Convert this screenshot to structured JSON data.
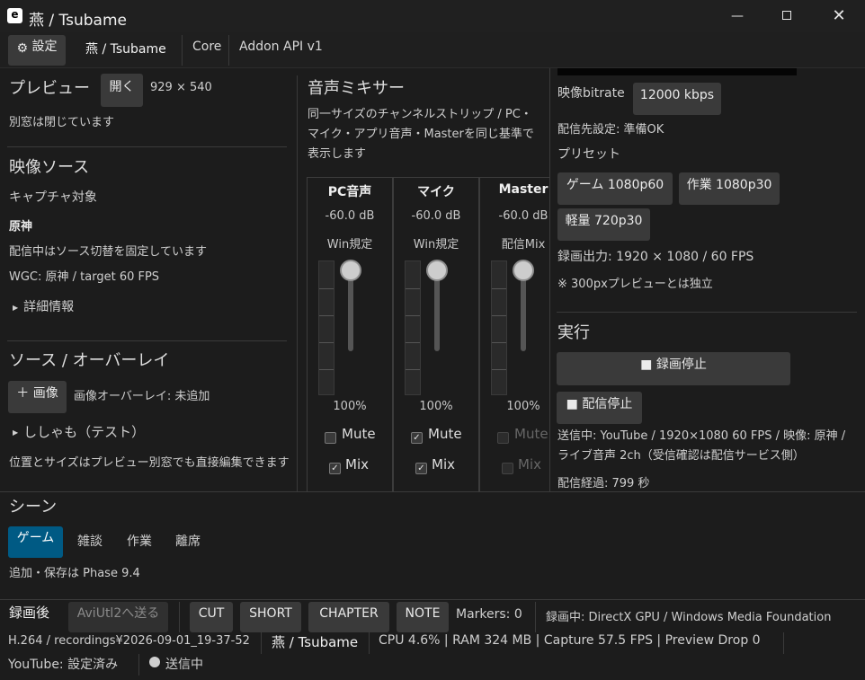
{
  "window": {
    "app_icon": "e",
    "title": "燕 / Tsubame"
  },
  "menu": {
    "settings_label": "設定",
    "tabs": [
      "燕 / Tsubame",
      "Core",
      "Addon API v1"
    ]
  },
  "preview": {
    "title": "プレビュー",
    "open_label": "開く",
    "size": "929 × 540",
    "status": "別窓は閉じています"
  },
  "video_source": {
    "title": "映像ソース",
    "capture_target_label": "キャプチャ対象",
    "capture_target": "原神",
    "note": "配信中はソース切替を固定しています",
    "wgc": "WGC: 原神 / target 60 FPS",
    "details_label": "詳細情報"
  },
  "overlay": {
    "title": "ソース / オーバーレイ",
    "add_image_label": "＋ 画像",
    "image_status": "画像オーバーレイ: 未追加",
    "item": "ししゃも（テスト）",
    "note": "位置とサイズはプレビュー別窓でも直接編集できます"
  },
  "mixer": {
    "title": "音声ミキサー",
    "description": "同一サイズのチャンネルストリップ / PC・マイク・アプリ音声・Masterを同じ基準で表示します",
    "strips": [
      {
        "name": "PC音声",
        "db": "-60.0 dB",
        "source": "Win規定",
        "level": "100%",
        "mute": false,
        "mix": true,
        "mute_label": "Mute",
        "mix_label": "Mix"
      },
      {
        "name": "マイク",
        "db": "-60.0 dB",
        "source": "Win規定",
        "level": "100%",
        "mute": true,
        "mix": true,
        "mute_label": "Mute",
        "mix_label": "Mix"
      },
      {
        "name": "Master",
        "db": "-60.0 dB",
        "source": "配信Mix",
        "level": "100%",
        "mute": false,
        "mix": false,
        "mute_label": "Mute",
        "mix_label": "Mix"
      }
    ]
  },
  "stream": {
    "bitrate_label": "映像bitrate",
    "bitrate": "12000 kbps",
    "dest_status": "配信先設定: 準備OK",
    "presets_label": "プリセット",
    "presets": [
      "ゲーム 1080p60",
      "作業 1080p30",
      "軽量 720p30"
    ],
    "record_output": "録画出力: 1920 × 1080 / 60 FPS",
    "independent_note": "※ 300pxプレビューとは独立",
    "run_label": "実行",
    "stop_record_label": "■ 録画停止",
    "stop_stream_label": "■ 配信停止",
    "streaming_info": "送信中: YouTube / 1920×1080 60 FPS / 映像: 原神 / ライブ音声 2ch（受信確認は配信サービス側）",
    "elapsed": "配信経過: 799 秒"
  },
  "scene": {
    "title": "シーン",
    "tabs": [
      "ゲーム",
      "雑談",
      "作業",
      "離席"
    ],
    "active": 0,
    "note": "追加・保存は Phase 9.4"
  },
  "post": {
    "label": "録画後",
    "aviutl_label": "AviUtl2へ送る",
    "markers": [
      "CUT",
      "SHORT",
      "CHAPTER",
      "NOTE"
    ],
    "markers_count": "Markers: 0",
    "rec_info": "録画中: DirectX GPU / Windows Media Foundation"
  },
  "status": {
    "file": "H.264 / recordings¥2026-09-01_19-37-52",
    "app": "燕 / Tsubame",
    "perf": "CPU 4.6% | RAM 324 MB | Capture 57.5 FPS | Preview Drop 0",
    "youtube": "YouTube: 設定済み",
    "live": "送信中"
  }
}
